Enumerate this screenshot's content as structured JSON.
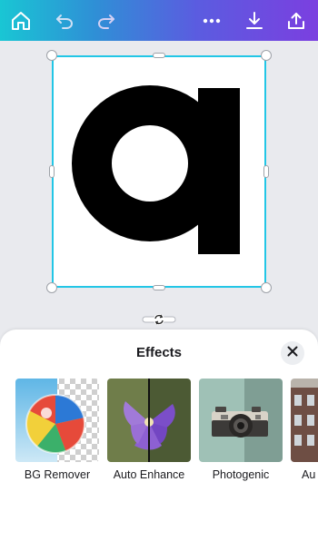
{
  "toolbar": {
    "icons": [
      "home-icon",
      "undo-icon",
      "redo-icon",
      "more-icon",
      "download-icon",
      "share-icon"
    ]
  },
  "design": {
    "glyph": "a"
  },
  "effects_panel": {
    "title": "Effects",
    "close_icon": "close-icon",
    "effects": [
      {
        "label": "BG Remover"
      },
      {
        "label": "Auto Enhance"
      },
      {
        "label": "Photogenic"
      },
      {
        "label": "Au"
      }
    ]
  },
  "colors": {
    "selection": "#22c6e6",
    "gradient_start": "#19c6d4",
    "gradient_end": "#7b3fe0"
  }
}
